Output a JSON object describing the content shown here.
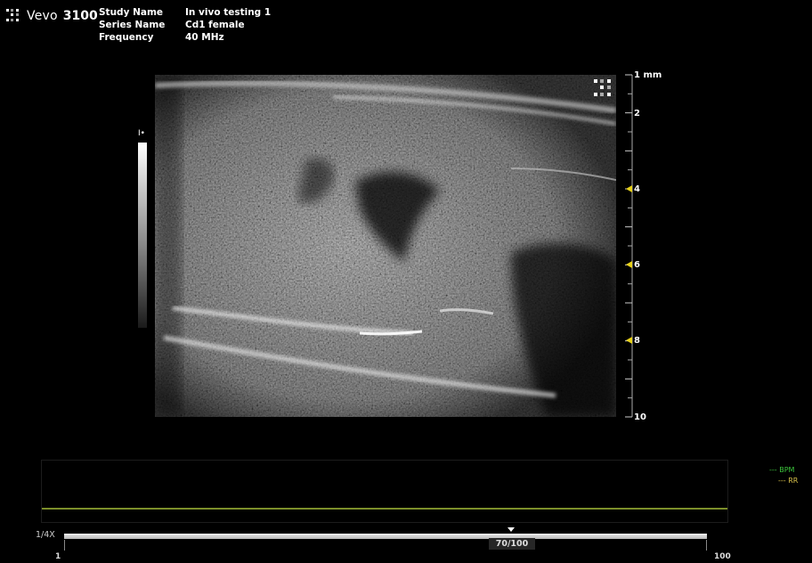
{
  "header": {
    "brand_name": "Vevo",
    "brand_model": "3100",
    "study_label": "Study Name",
    "study_value": "In vivo testing 1",
    "series_label": "Series Name",
    "series_value": "Cd1 female",
    "frequency_label": "Frequency",
    "frequency_value": "40 MHz"
  },
  "depth_scale": {
    "unit": "mm",
    "labels": [
      "1 mm",
      "2",
      "4",
      "6",
      "8",
      "10"
    ],
    "focus_markers": [
      "4",
      "6",
      "8"
    ],
    "marker_color": "#e8d21a"
  },
  "gain": {
    "marker": "I•"
  },
  "physio": {
    "legend": [
      {
        "label": "--- BPM",
        "color": "#3bc43b"
      },
      {
        "label": "--- RR",
        "color": "#d8c04a"
      }
    ]
  },
  "cine": {
    "speed": "1/4X",
    "frame_counter": "70/100",
    "current_frame": 70,
    "total_frames": 100,
    "start_label": "1",
    "end_label": "100"
  },
  "icons": [
    "vevo-logo-icon",
    "overlay-logo-icon",
    "focus-marker-icon",
    "playhead-marker-icon"
  ]
}
